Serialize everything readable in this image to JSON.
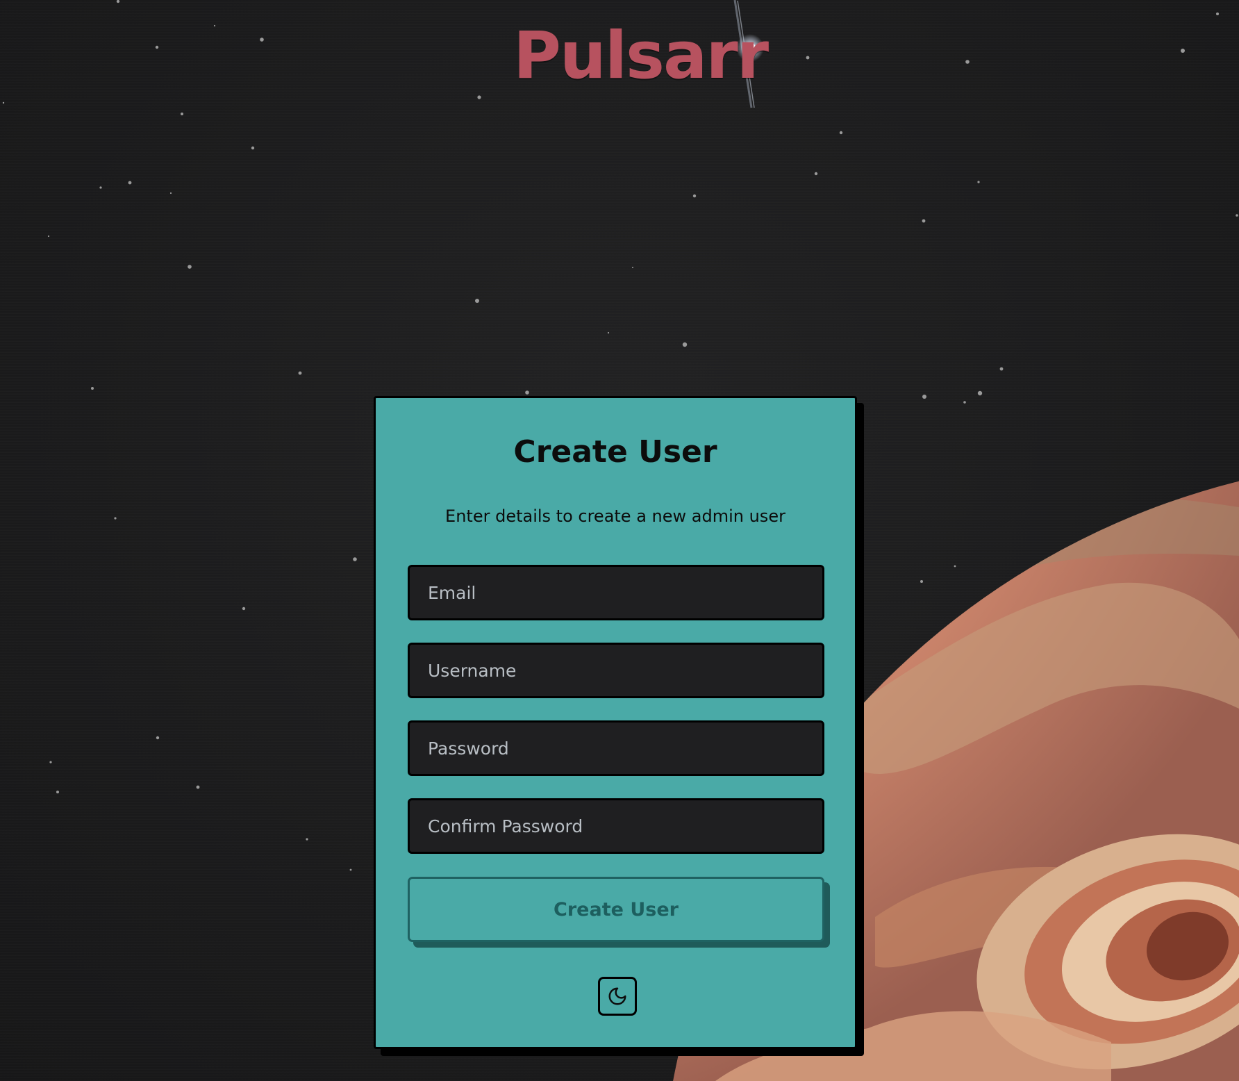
{
  "app": {
    "logo_text": "Pulsarr"
  },
  "card": {
    "title": "Create User",
    "subtitle": "Enter details to create a new admin user",
    "fields": {
      "email_placeholder": "Email",
      "username_placeholder": "Username",
      "password_placeholder": "Password",
      "confirm_password_placeholder": "Confirm Password"
    },
    "submit_label": "Create User",
    "theme_toggle_icon": "moon-icon"
  },
  "colors": {
    "background": "#1c1c1d",
    "card": "#4aaaa7",
    "logo": "#b7525f",
    "input_bg": "#1f1f21",
    "button_text": "#1d5f5f"
  }
}
